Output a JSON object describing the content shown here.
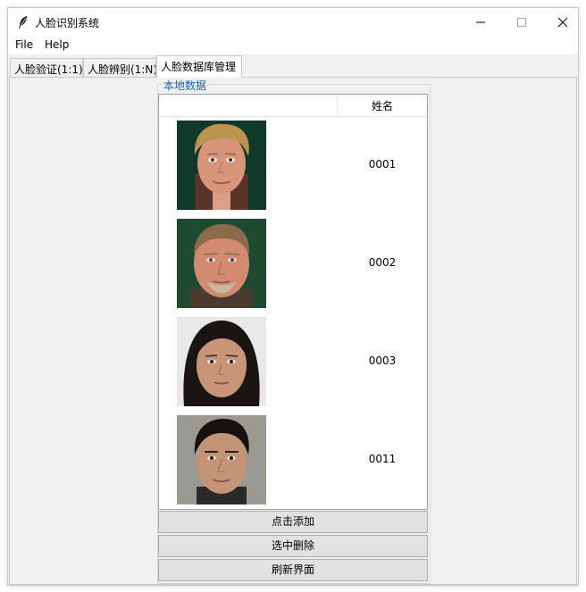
{
  "window": {
    "title": "人脸识别系统"
  },
  "menu": {
    "items": [
      {
        "label": "File"
      },
      {
        "label": "Help"
      }
    ]
  },
  "tabs": [
    {
      "label": "人脸验证(1:1)"
    },
    {
      "label": "人脸辨别(1:N)"
    },
    {
      "label": "人脸数据库管理",
      "active": true
    }
  ],
  "database": {
    "group_label": "本地数据",
    "column_header": "姓名",
    "rows": [
      {
        "name": "0001",
        "photo": "face-photo-blond-man"
      },
      {
        "name": "0002",
        "photo": "face-photo-bearded-man"
      },
      {
        "name": "0003",
        "photo": "face-photo-woman"
      },
      {
        "name": "0011",
        "photo": "face-photo-young-man"
      }
    ]
  },
  "buttons": {
    "add": "点击添加",
    "delete": "选中删除",
    "refresh": "刷新界面"
  },
  "colors": {
    "group_label": "#1f5fb8",
    "window_bg": "#f0f0f0",
    "button_bg": "#e1e1e1"
  }
}
